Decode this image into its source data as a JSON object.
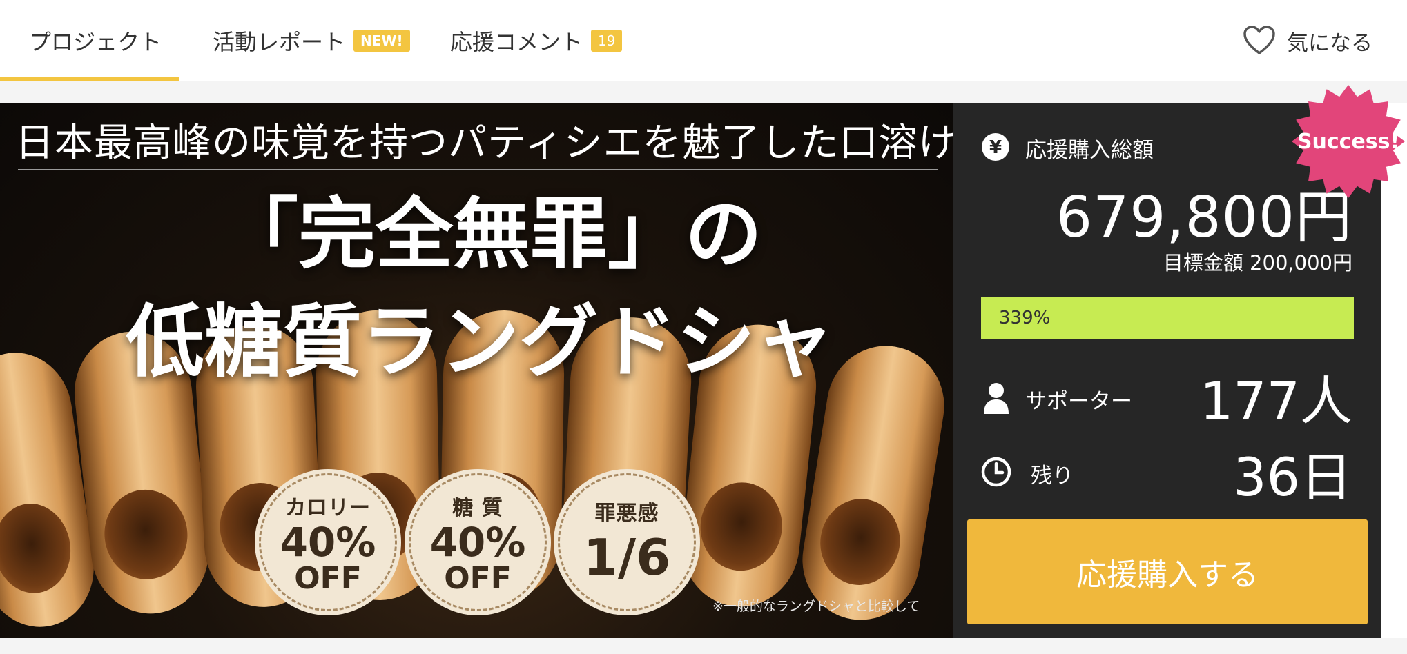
{
  "tabs": [
    {
      "label": "プロジェクト",
      "active": true
    },
    {
      "label": "活動レポート",
      "badge": "NEW!"
    },
    {
      "label": "応援コメント",
      "badge": "19"
    }
  ],
  "favorite": {
    "label": "気になる",
    "icon": "heart-outline-icon"
  },
  "hero": {
    "headline": "日本最高峰の味覚を持つパティシエを魅了した口溶け",
    "title_line1": "「完全無罪」の",
    "title_line2": "低糖質ラングドシャ",
    "circles": [
      {
        "title": "カロリー",
        "value": "40%",
        "suffix": "OFF"
      },
      {
        "title": "糖 質",
        "value": "40%",
        "suffix": "OFF"
      },
      {
        "title": "罪悪感",
        "value": "1/6"
      }
    ],
    "note": "※一般的なラングドシャと比較して"
  },
  "stats": {
    "total_label": "応援購入総額",
    "total_icon": "yen-icon",
    "total_amount": "679,800円",
    "goal_text": "目標金額 200,000円",
    "progress_percent": 339,
    "progress_label": "339%",
    "supporters_label": "サポーター",
    "supporters_icon": "person-icon",
    "supporters_value": "177人",
    "remaining_label": "残り",
    "remaining_icon": "clock-icon",
    "remaining_value": "36日",
    "cta_label": "応援購入する",
    "success_badge": "Success!"
  },
  "colors": {
    "accent": "#f3c540",
    "cta": "#f0b83c",
    "progress": "#c7eb52",
    "success": "#e2457a",
    "panel": "#262626"
  }
}
